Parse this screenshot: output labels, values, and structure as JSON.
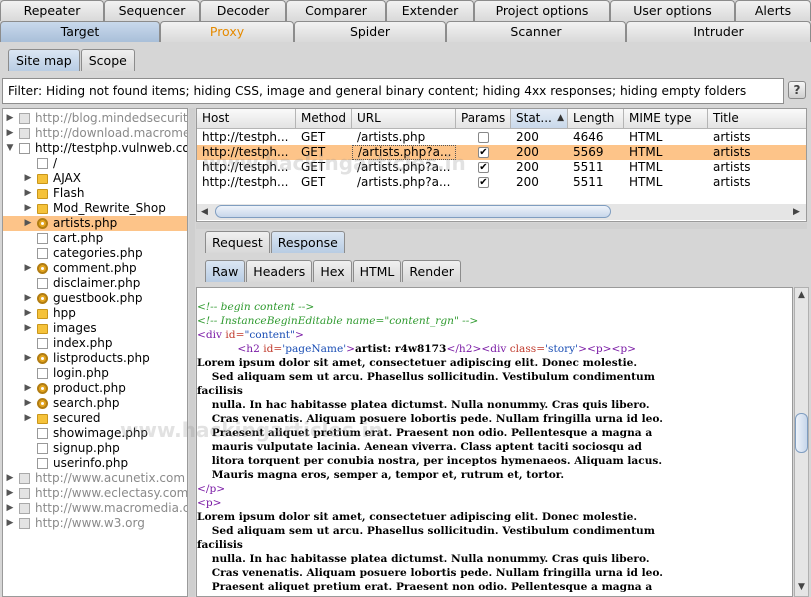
{
  "top_tabs_row1": [
    "Repeater",
    "Sequencer",
    "Decoder",
    "Comparer",
    "Extender",
    "Project options",
    "User options",
    "Alerts"
  ],
  "top_tabs_row2": [
    "Target",
    "Proxy",
    "Spider",
    "Scanner",
    "Intruder"
  ],
  "target_subtabs": [
    "Site map",
    "Scope"
  ],
  "filter_text": "Filter: Hiding not found items;  hiding CSS, image and general binary content;  hiding 4xx responses;  hiding empty folders",
  "help_label": "?",
  "site_tree": [
    {
      "label": "http://blog.mindedsecurity",
      "type": "host-dim",
      "depth": 0,
      "arrow": "▶"
    },
    {
      "label": "http://download.macromed",
      "type": "host-dim",
      "depth": 0,
      "arrow": "▶"
    },
    {
      "label": "http://testphp.vulnweb.com",
      "type": "host",
      "depth": 0,
      "arrow": "▼"
    },
    {
      "label": "/",
      "type": "page",
      "depth": 1,
      "arrow": ""
    },
    {
      "label": "AJAX",
      "type": "folder",
      "depth": 1,
      "arrow": "▶"
    },
    {
      "label": "Flash",
      "type": "folder",
      "depth": 1,
      "arrow": "▶"
    },
    {
      "label": "Mod_Rewrite_Shop",
      "type": "folder",
      "depth": 1,
      "arrow": "▶"
    },
    {
      "label": "artists.php",
      "type": "gear",
      "depth": 1,
      "arrow": "▶",
      "selected": true
    },
    {
      "label": "cart.php",
      "type": "page",
      "depth": 1,
      "arrow": ""
    },
    {
      "label": "categories.php",
      "type": "page",
      "depth": 1,
      "arrow": ""
    },
    {
      "label": "comment.php",
      "type": "gear",
      "depth": 1,
      "arrow": "▶"
    },
    {
      "label": "disclaimer.php",
      "type": "page",
      "depth": 1,
      "arrow": ""
    },
    {
      "label": "guestbook.php",
      "type": "gear",
      "depth": 1,
      "arrow": "▶"
    },
    {
      "label": "hpp",
      "type": "folder",
      "depth": 1,
      "arrow": "▶"
    },
    {
      "label": "images",
      "type": "folder",
      "depth": 1,
      "arrow": "▶"
    },
    {
      "label": "index.php",
      "type": "page",
      "depth": 1,
      "arrow": ""
    },
    {
      "label": "listproducts.php",
      "type": "gear",
      "depth": 1,
      "arrow": "▶"
    },
    {
      "label": "login.php",
      "type": "page",
      "depth": 1,
      "arrow": ""
    },
    {
      "label": "product.php",
      "type": "gear",
      "depth": 1,
      "arrow": "▶"
    },
    {
      "label": "search.php",
      "type": "gear",
      "depth": 1,
      "arrow": "▶"
    },
    {
      "label": "secured",
      "type": "folder",
      "depth": 1,
      "arrow": "▶"
    },
    {
      "label": "showimage.php",
      "type": "page",
      "depth": 1,
      "arrow": ""
    },
    {
      "label": "signup.php",
      "type": "page",
      "depth": 1,
      "arrow": ""
    },
    {
      "label": "userinfo.php",
      "type": "page",
      "depth": 1,
      "arrow": ""
    },
    {
      "label": "http://www.acunetix.com",
      "type": "host-dim",
      "depth": 0,
      "arrow": "▶"
    },
    {
      "label": "http://www.eclectasy.com",
      "type": "host-dim",
      "depth": 0,
      "arrow": "▶"
    },
    {
      "label": "http://www.macromedia.co",
      "type": "host-dim",
      "depth": 0,
      "arrow": "▶"
    },
    {
      "label": "http://www.w3.org",
      "type": "host-dim",
      "depth": 0,
      "arrow": "▶"
    }
  ],
  "table": {
    "columns": [
      "Host",
      "Method",
      "URL",
      "Params",
      "Stat...",
      "Length",
      "MIME type",
      "Title"
    ],
    "sort_indicator": "▲",
    "rows": [
      {
        "host": "http://testph...",
        "method": "GET",
        "url": "/artists.php",
        "params": false,
        "status": "200",
        "length": "4646",
        "mime": "HTML",
        "title": "artists"
      },
      {
        "host": "http://testph...",
        "method": "GET",
        "url": "/artists.php?a...",
        "params": true,
        "status": "200",
        "length": "5569",
        "mime": "HTML",
        "title": "artists",
        "selected": true
      },
      {
        "host": "http://testph...",
        "method": "GET",
        "url": "/artists.php?a...",
        "params": true,
        "status": "200",
        "length": "5511",
        "mime": "HTML",
        "title": "artists"
      },
      {
        "host": "http://testph...",
        "method": "GET",
        "url": "/artists.php?a...",
        "params": true,
        "status": "200",
        "length": "5511",
        "mime": "HTML",
        "title": "artists"
      }
    ]
  },
  "req_resp_tabs": [
    "Request",
    "Response"
  ],
  "view_tabs": [
    "Raw",
    "Headers",
    "Hex",
    "HTML",
    "Render"
  ],
  "response_lines": [
    [
      {
        "c": "cmt",
        "t": "<!-- begin content -->"
      }
    ],
    [
      {
        "c": "cmt",
        "t": "<!-- InstanceBeginEditable name=\"content_rgn\" -->"
      }
    ],
    [
      {
        "c": "tag",
        "t": "<div "
      },
      {
        "c": "attr",
        "t": "id="
      },
      {
        "c": "val",
        "t": "\"content\""
      },
      {
        "c": "tag",
        "t": ">"
      }
    ],
    [
      {
        "c": "",
        "t": "            "
      },
      {
        "c": "tag",
        "t": "<h2 "
      },
      {
        "c": "attr",
        "t": "id="
      },
      {
        "c": "val",
        "t": "'pageName'"
      },
      {
        "c": "tag",
        "t": ">"
      },
      {
        "c": "bld",
        "t": "artist: r4w8173"
      },
      {
        "c": "tag",
        "t": "</h2><div "
      },
      {
        "c": "attr",
        "t": "class="
      },
      {
        "c": "val",
        "t": "'story'"
      },
      {
        "c": "tag",
        "t": "><p><p>"
      }
    ],
    [
      {
        "c": "bld",
        "t": "Lorem ipsum dolor sit amet, consectetuer adipiscing elit. Donec molestie."
      }
    ],
    [
      {
        "c": "bld",
        "t": "    Sed aliquam sem ut arcu. Phasellus sollicitudin. Vestibulum condimentum"
      }
    ],
    [
      {
        "c": "bld",
        "t": "facilisis"
      }
    ],
    [
      {
        "c": "bld",
        "t": "    nulla. In hac habitasse platea dictumst. Nulla nonummy. Cras quis libero."
      }
    ],
    [
      {
        "c": "bld",
        "t": "    Cras venenatis. Aliquam posuere lobortis pede. Nullam fringilla urna id leo."
      }
    ],
    [
      {
        "c": "bld",
        "t": "    Praesent aliquet pretium erat. Praesent non odio. Pellentesque a magna a"
      }
    ],
    [
      {
        "c": "bld",
        "t": "    mauris vulputate lacinia. Aenean viverra. Class aptent taciti sociosqu ad"
      }
    ],
    [
      {
        "c": "bld",
        "t": "    litora torquent per conubia nostra, per inceptos hymenaeos. Aliquam lacus."
      }
    ],
    [
      {
        "c": "bld",
        "t": "    Mauris magna eros, semper a, tempor et, rutrum et, tortor."
      }
    ],
    [
      {
        "c": "tag",
        "t": "</p>"
      }
    ],
    [
      {
        "c": "tag",
        "t": "<p>"
      }
    ],
    [
      {
        "c": "bld",
        "t": "Lorem ipsum dolor sit amet, consectetuer adipiscing elit. Donec molestie."
      }
    ],
    [
      {
        "c": "bld",
        "t": "    Sed aliquam sem ut arcu. Phasellus sollicitudin. Vestibulum condimentum"
      }
    ],
    [
      {
        "c": "bld",
        "t": "facilisis"
      }
    ],
    [
      {
        "c": "bld",
        "t": "    nulla. In hac habitasse platea dictumst. Nulla nonummy. Cras quis libero."
      }
    ],
    [
      {
        "c": "bld",
        "t": "    Cras venenatis. Aliquam posuere lobortis pede. Nullam fringilla urna id leo."
      }
    ],
    [
      {
        "c": "bld",
        "t": "    Praesent aliquet pretium erat. Praesent non odio. Pellentesque a magna a"
      }
    ]
  ],
  "watermark": "www.hackingarticles.in",
  "colors": {
    "selection": "#fdc489",
    "proxy_tab_text": "#e58a00",
    "comment": "#2f9a2f",
    "tag": "#7a1aa5"
  }
}
